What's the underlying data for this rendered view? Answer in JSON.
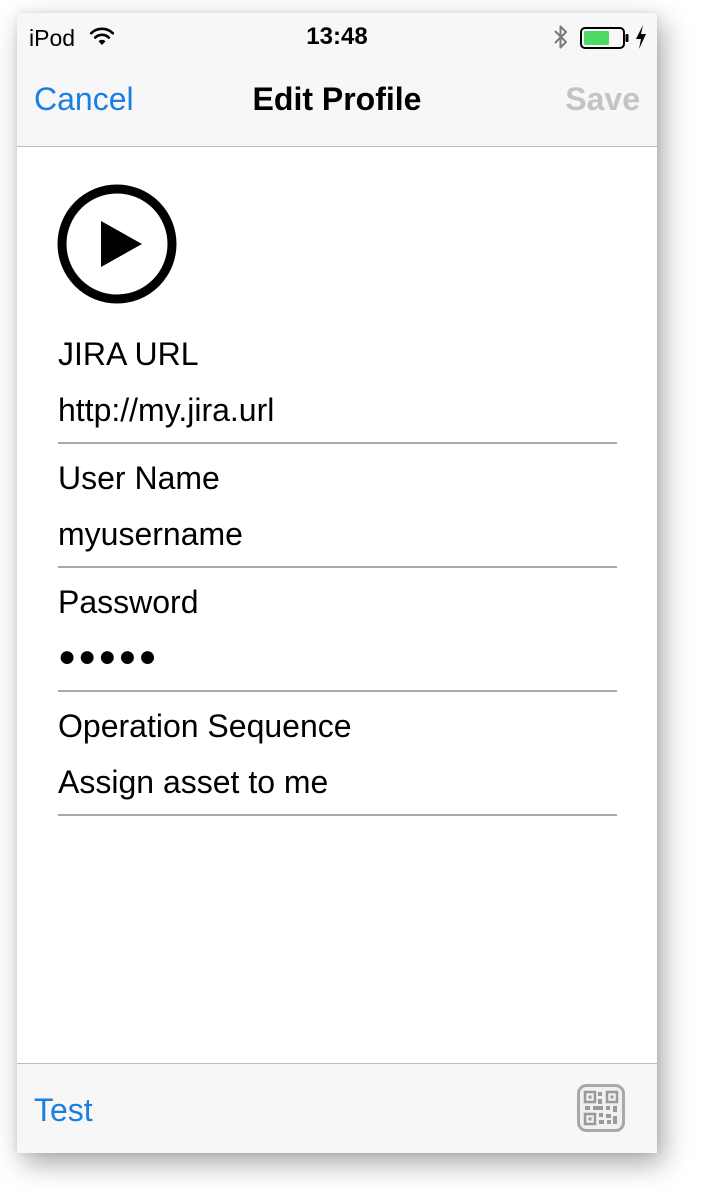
{
  "status_bar": {
    "carrier": "iPod",
    "time": "13:48",
    "icons": [
      "wifi-icon",
      "bluetooth-icon",
      "battery-icon",
      "charging-bolt-icon"
    ],
    "battery_color": "#4cd964"
  },
  "nav": {
    "cancel_label": "Cancel",
    "title": "Edit Profile",
    "save_label": "Save"
  },
  "profile": {
    "icon": "play-circle-icon"
  },
  "fields": [
    {
      "label": "JIRA URL",
      "value": "http://my.jira.url"
    },
    {
      "label": "User Name",
      "value": "myusername"
    },
    {
      "label": "Password",
      "value": "●●●●●"
    },
    {
      "label": "Operation Sequence",
      "value": "Assign asset to me"
    }
  ],
  "toolbar": {
    "test_label": "Test",
    "qr_icon": "qr-code-icon"
  },
  "colors": {
    "accent": "#1a7fe0",
    "disabled": "#c4c4c6"
  }
}
